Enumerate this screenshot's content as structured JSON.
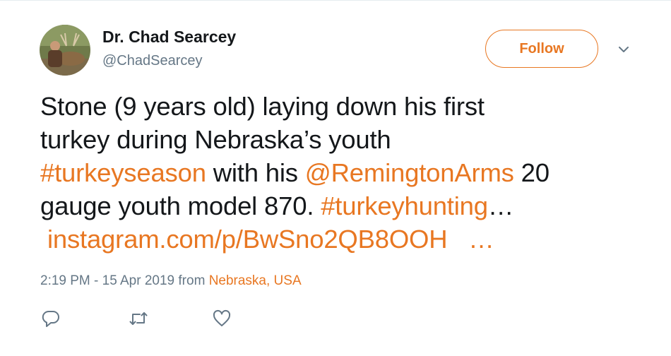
{
  "user": {
    "display_name": "Dr. Chad Searcey",
    "handle": "@ChadSearcey",
    "avatar_icon": "profile-photo-hunter-with-deer"
  },
  "follow_label": "Follow",
  "tweet": {
    "line1": "Stone (9 years old) laying down his first",
    "line2": "turkey during Nebraska’s youth",
    "line3_hashtag": "#turkeyseason",
    "line3_text": " with his ",
    "line3_mention": "@RemingtonArms",
    "line3_end": " 20",
    "line4_text": "gauge youth model 870. ",
    "line4_hashtag": "#turkeyhunting",
    "line4_ellipsis": "…",
    "line5_url": "instagram.com/p/BwSno2QB8OOH",
    "line5_ellipsis": "…"
  },
  "meta": {
    "time_date": "2:19 PM - 15 Apr 2019",
    "from_label": " from ",
    "location": "Nebraska, USA"
  },
  "icons": {
    "reply": "reply-icon",
    "retweet": "retweet-icon",
    "like": "heart-icon",
    "caret": "chevron-down-icon"
  },
  "colors": {
    "accent": "#e87722",
    "text": "#14171a",
    "muted": "#657786"
  }
}
